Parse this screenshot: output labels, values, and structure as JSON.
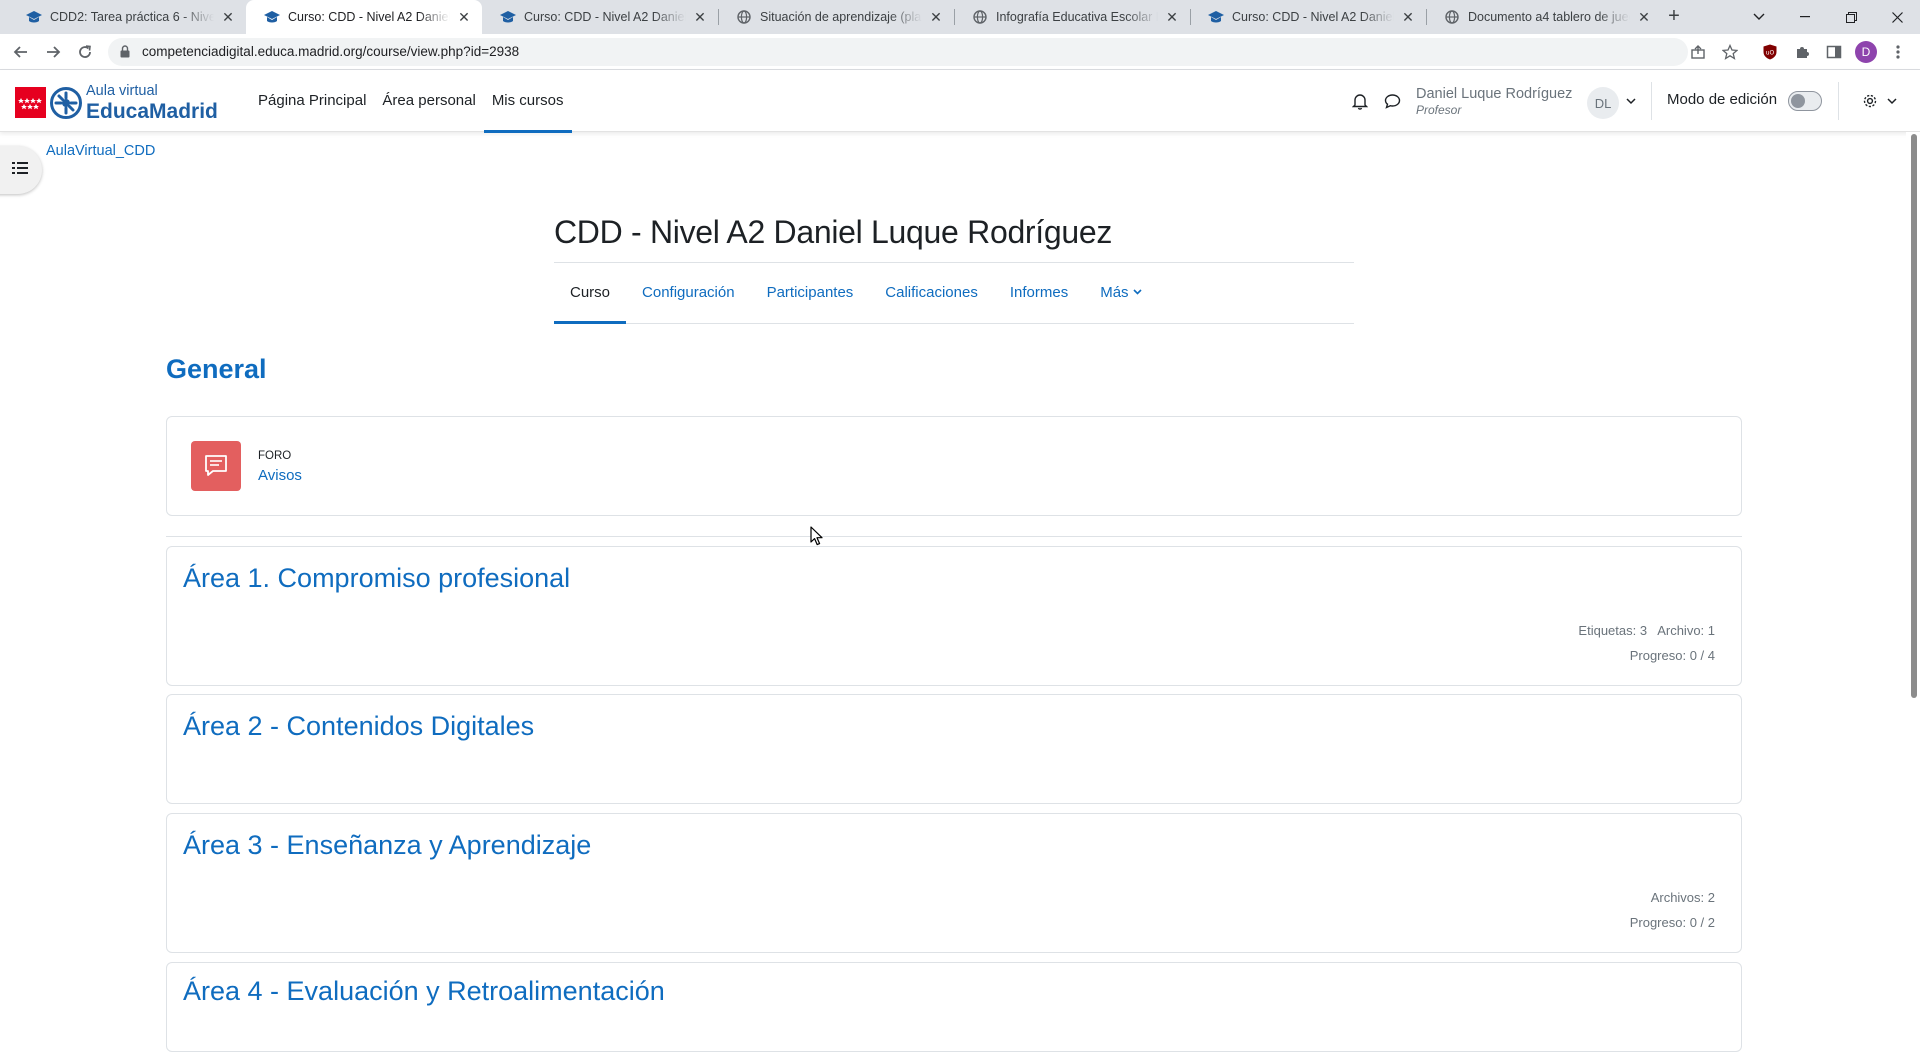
{
  "browser": {
    "tabs": [
      {
        "title": "CDD2: Tarea práctica 6 - Nivel A2",
        "favicon": "moodle-cap-icon",
        "active": false
      },
      {
        "title": "Curso: CDD - Nivel A2 Daniel Luque",
        "favicon": "moodle-cap-icon",
        "active": true
      },
      {
        "title": "Curso: CDD - Nivel A2 Daniel Luque",
        "favicon": "moodle-cap-icon",
        "active": false
      },
      {
        "title": "Situación de aprendizaje (plantilla)",
        "favicon": "globe-icon",
        "active": false
      },
      {
        "title": "Infografía Educativa Escolar Dibujos",
        "favicon": "globe-icon",
        "active": false
      },
      {
        "title": "Curso: CDD - Nivel A2 Daniel Luque",
        "favicon": "moodle-cap-icon",
        "active": false
      },
      {
        "title": "Documento a4 tablero de juego",
        "favicon": "globe-icon",
        "active": false
      }
    ],
    "url": "competenciadigital.educa.madrid.org/course/view.php?id=2938",
    "profile_initial": "D"
  },
  "site": {
    "logo_line1": "Aula virtual",
    "logo_line2": "EducaMadrid",
    "nav": [
      {
        "label": "Página Principal",
        "active": false
      },
      {
        "label": "Área personal",
        "active": false
      },
      {
        "label": "Mis cursos",
        "active": true
      }
    ],
    "user_name": "Daniel Luque Rodríguez",
    "user_role": "Profesor",
    "user_initials": "DL",
    "edit_mode_label": "Modo de edición",
    "edit_mode_on": false
  },
  "breadcrumb": "AulaVirtual_CDD",
  "course": {
    "title": "CDD - Nivel A2 Daniel Luque Rodríguez",
    "tabs": [
      {
        "label": "Curso",
        "active": true
      },
      {
        "label": "Configuración",
        "active": false
      },
      {
        "label": "Participantes",
        "active": false
      },
      {
        "label": "Calificaciones",
        "active": false
      },
      {
        "label": "Informes",
        "active": false
      },
      {
        "label": "Más",
        "active": false
      }
    ]
  },
  "general": {
    "title": "General",
    "activity_type": "FORO",
    "activity_name": "Avisos"
  },
  "areas": [
    {
      "title": "Área 1. Compromiso profesional",
      "meta1": "Etiquetas: 3   Archivo: 1",
      "meta2": "Progreso: 0 / 4"
    },
    {
      "title": "Área 2 - Contenidos Digitales",
      "meta1": "",
      "meta2": ""
    },
    {
      "title": "Área 3 - Enseñanza y Aprendizaje",
      "meta1": "Archivos: 2",
      "meta2": "Progreso: 0 / 2"
    },
    {
      "title": "Área 4 - Evaluación y Retroalimentación",
      "meta1": "",
      "meta2": ""
    }
  ],
  "colors": {
    "accent": "#0f6cbf",
    "forum_icon_bg": "#e35f5f",
    "madrid_red": "#e6001f"
  }
}
